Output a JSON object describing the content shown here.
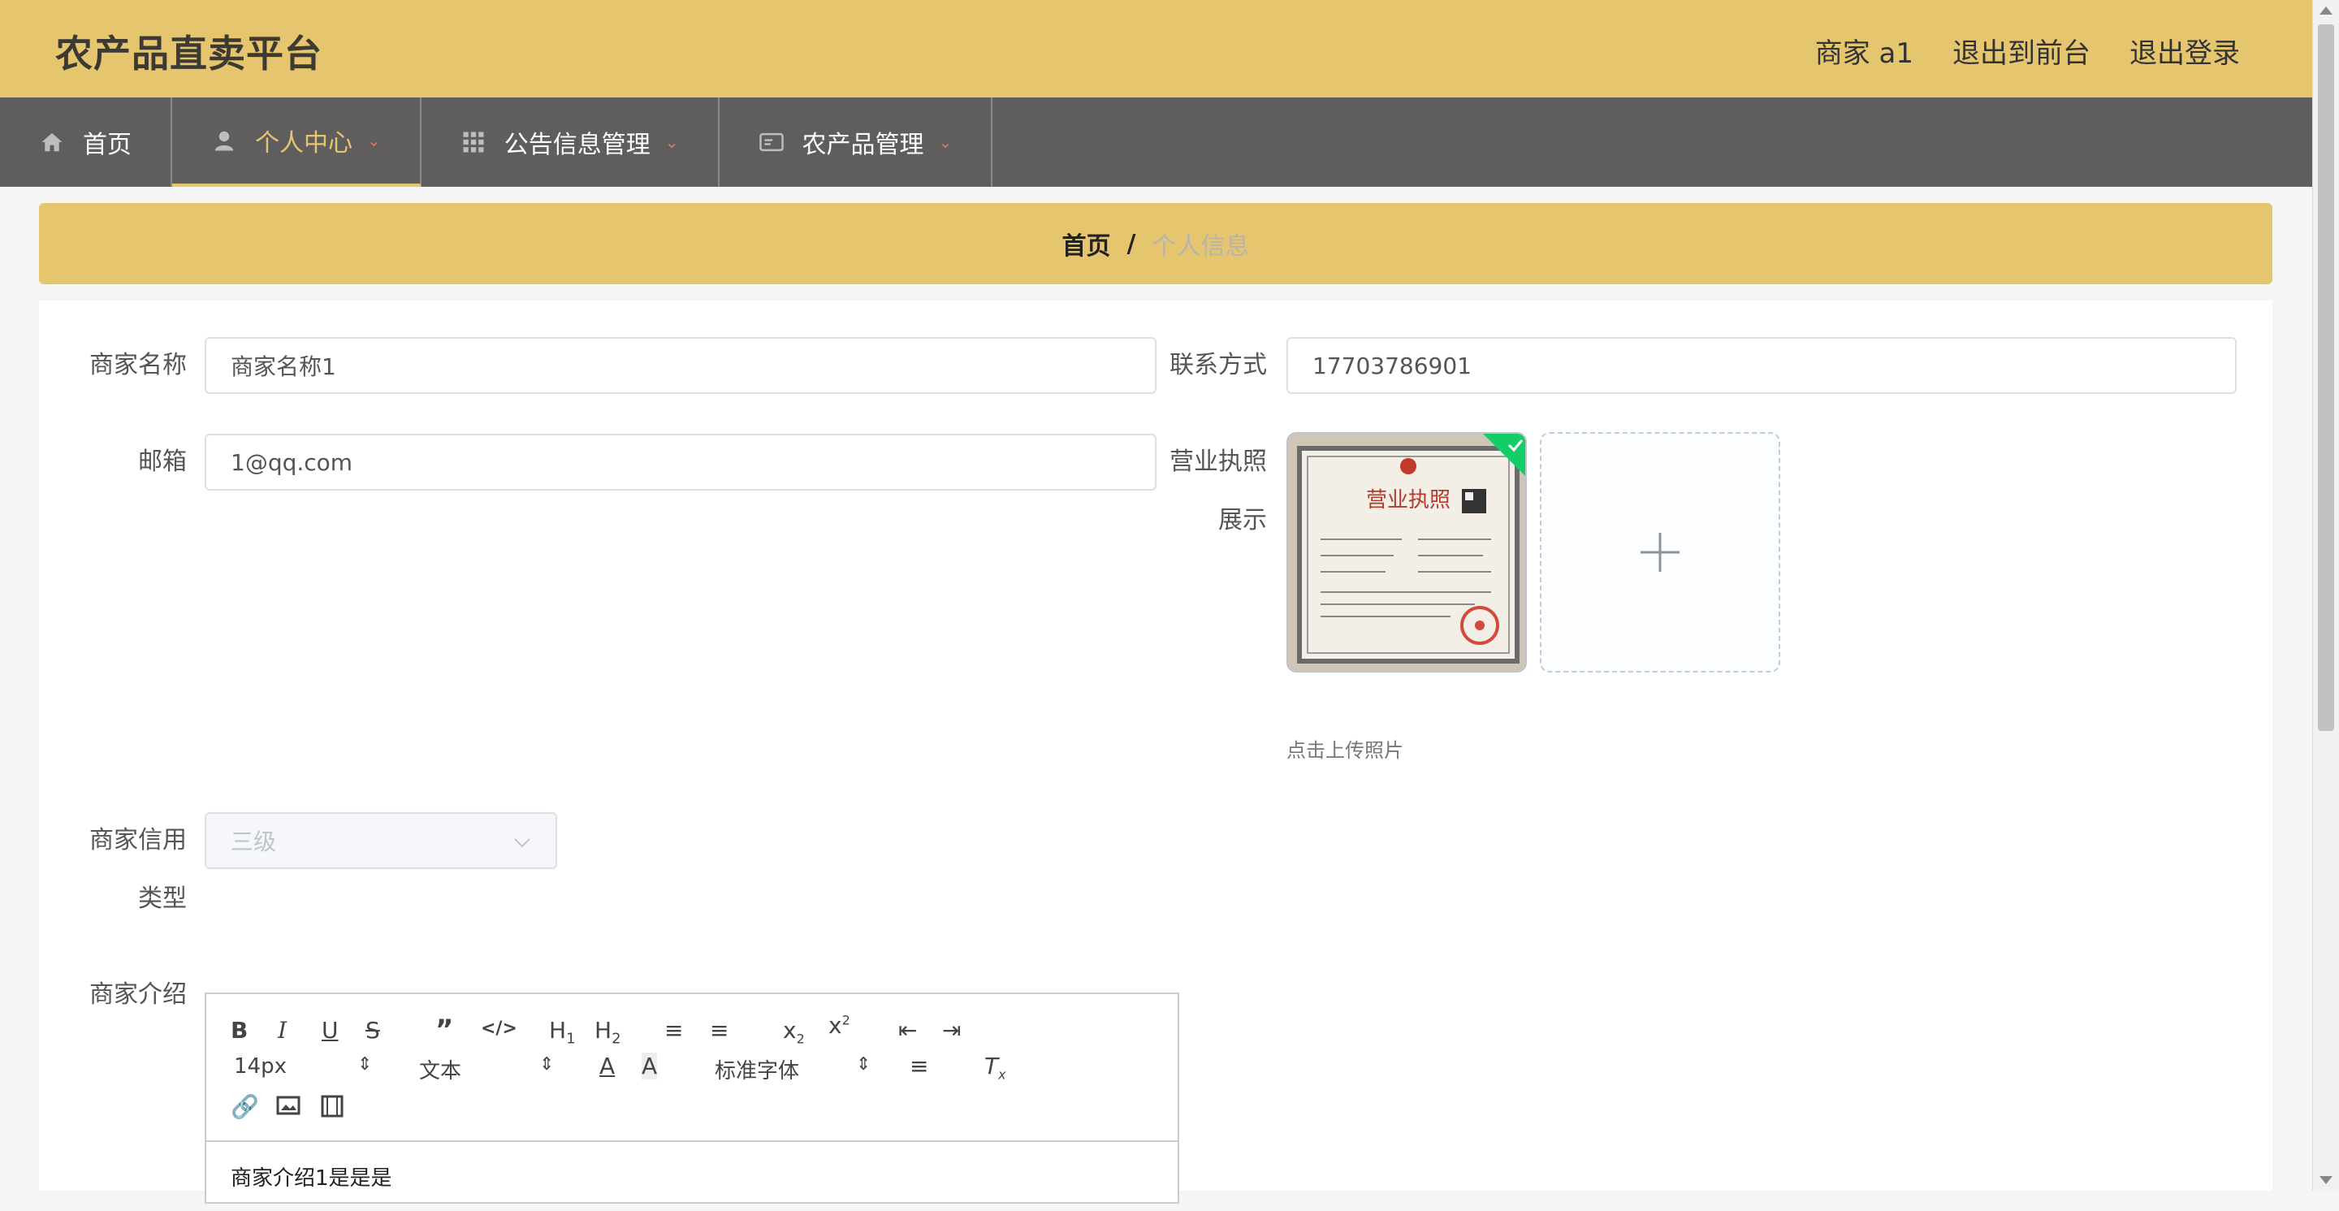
{
  "header": {
    "brand": "农产品直卖平台",
    "user": "商家 a1",
    "to_front": "退出到前台",
    "logout": "退出登录"
  },
  "nav": {
    "items": [
      {
        "label": "首页",
        "icon": "home-icon"
      },
      {
        "label": "个人中心",
        "icon": "user-icon",
        "active": true
      },
      {
        "label": "公告信息管理",
        "icon": "grid-icon"
      },
      {
        "label": "农产品管理",
        "icon": "card-icon"
      }
    ]
  },
  "breadcrumb": {
    "home": "首页",
    "sep": "/",
    "current": "个人信息"
  },
  "form": {
    "merchant_name_label": "商家名称",
    "merchant_name_value": "商家名称1",
    "contact_label": "联系方式",
    "contact_value": "17703786901",
    "email_label": "邮箱",
    "email_value": "1@qq.com",
    "license_label_1": "营业执照",
    "license_label_2": "展示",
    "upload_tip": "点击上传照片",
    "credit_label_1": "商家信用",
    "credit_label_2": "类型",
    "credit_value": "三级",
    "intro_label": "商家介绍",
    "intro_content": "商家介绍1是是是"
  },
  "editor": {
    "font_size": "14px",
    "heading": "文本",
    "font_family": "标准字体"
  },
  "license_image": {
    "title": "营业执照"
  },
  "colors": {
    "accent": "#e6c56f",
    "nav_bg": "#5f5d5e",
    "success": "#13ce66"
  }
}
